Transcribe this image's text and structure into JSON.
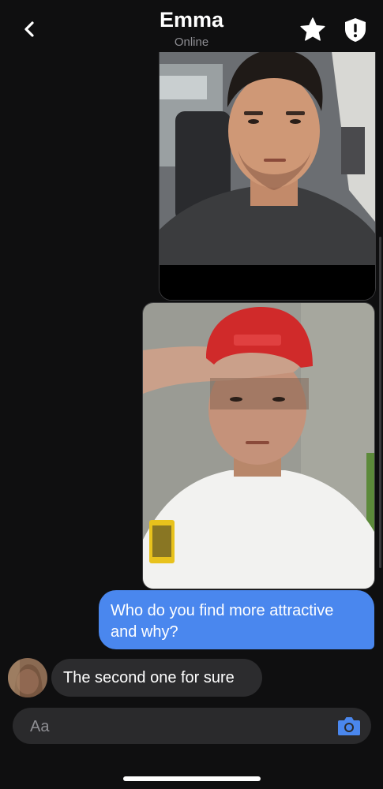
{
  "header": {
    "contact_name": "Emma",
    "status": "Online",
    "back_icon": "chevron-left-icon",
    "favorite_icon": "star-icon",
    "safety_icon": "shield-alert-icon"
  },
  "messages": [
    {
      "type": "photo",
      "direction": "outgoing",
      "description": "selfie-in-car"
    },
    {
      "type": "photo",
      "direction": "outgoing",
      "description": "selfie-red-cap"
    },
    {
      "type": "text",
      "direction": "outgoing",
      "text": "Who do you find more attractive and why?"
    },
    {
      "type": "text",
      "direction": "incoming",
      "text": "The second one for sure"
    }
  ],
  "composer": {
    "placeholder": "Aa",
    "camera_icon": "camera-icon"
  },
  "colors": {
    "background": "#0f0f10",
    "outgoing_bubble": "#4a87ee",
    "incoming_bubble": "#2c2c2e",
    "accent": "#4a87ee",
    "secondary_text": "#8e8e93"
  }
}
